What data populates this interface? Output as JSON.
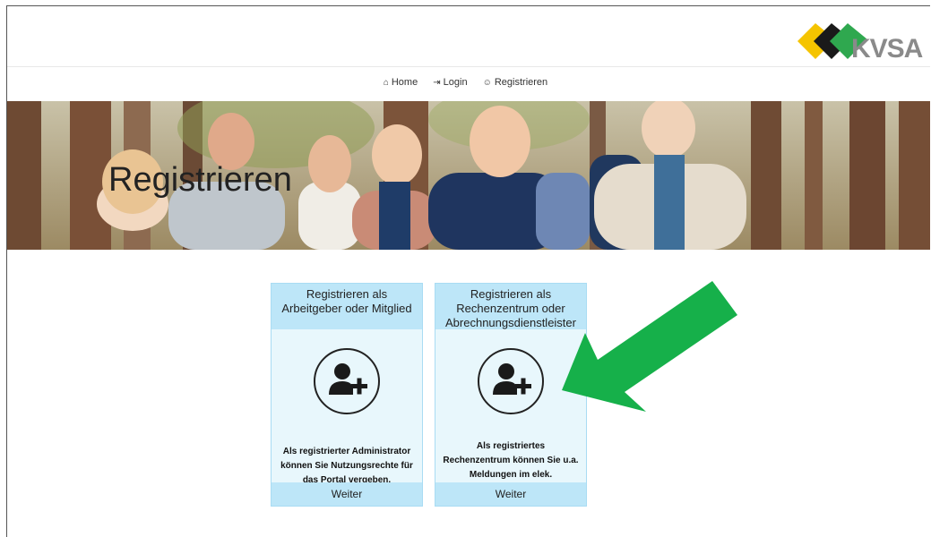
{
  "brand": {
    "logo_text": "KVSA"
  },
  "nav": {
    "items": [
      {
        "icon": "home-icon",
        "glyph": "⌂",
        "label": "Home"
      },
      {
        "icon": "login-icon",
        "glyph": "⇥",
        "label": "Login"
      },
      {
        "icon": "register-icon",
        "glyph": "☺",
        "label": "Registrieren"
      }
    ]
  },
  "hero": {
    "title": "Registrieren"
  },
  "cards": [
    {
      "header": "Registrieren als Arbeitgeber oder Mitglied",
      "icon": "user-add-icon",
      "description": "Als registrierter Administrator können Sie Nutzungsrechte für das Portal vergeben.",
      "footer": "Weiter"
    },
    {
      "header": "Registrieren als Rechenzentrum oder Abrechnungsdienstleister",
      "icon": "user-add-icon",
      "description": "Als registriertes Rechenzentrum können Sie u.a. Meldungen im elek. Datenaustausch übermitteln.",
      "footer": "Weiter"
    }
  ],
  "colors": {
    "card_header": "#bde6f8",
    "card_body": "#e8f7fc",
    "arrow": "#16b04a",
    "logo_yellow": "#f5c400",
    "logo_black": "#1a1a1a",
    "logo_green": "#2fa84f"
  }
}
